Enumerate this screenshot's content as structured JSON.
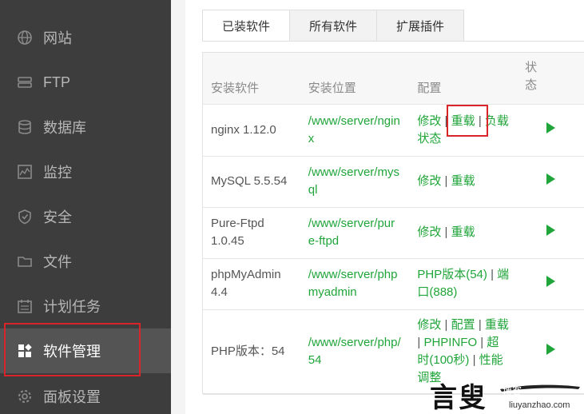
{
  "sidebar": {
    "items": [
      {
        "label": "网站",
        "icon": "globe-icon"
      },
      {
        "label": "FTP",
        "icon": "ftp-icon"
      },
      {
        "label": "数据库",
        "icon": "database-icon"
      },
      {
        "label": "监控",
        "icon": "monitor-icon"
      },
      {
        "label": "安全",
        "icon": "shield-icon"
      },
      {
        "label": "文件",
        "icon": "folder-icon"
      },
      {
        "label": "计划任务",
        "icon": "calendar-icon"
      },
      {
        "label": "软件管理",
        "icon": "apps-icon",
        "active": true
      },
      {
        "label": "面板设置",
        "icon": "gear-icon"
      }
    ]
  },
  "tabs": [
    {
      "label": "已装软件",
      "active": true
    },
    {
      "label": "所有软件"
    },
    {
      "label": "扩展插件"
    }
  ],
  "table": {
    "headers": [
      "安装软件",
      "安装位置",
      "配置",
      "状态"
    ],
    "rows": [
      {
        "name": "nginx 1.12.0",
        "path": "/www/server/nginx",
        "config": [
          "修改",
          "重载",
          "负载状态"
        ]
      },
      {
        "name": "MySQL 5.5.54",
        "path": "/www/server/mysql",
        "config": [
          "修改",
          "重载"
        ]
      },
      {
        "name": "Pure-Ftpd 1.0.45",
        "path": "/www/server/pure-ftpd",
        "config": [
          "修改",
          "重载"
        ]
      },
      {
        "name": "phpMyAdmin 4.4",
        "path": "/www/server/phpmyadmin",
        "config": [
          "PHP版本(54)",
          "端口(888)"
        ]
      },
      {
        "name": "PHP版本：54",
        "path": "/www/server/php/54",
        "config": [
          "修改",
          "配置",
          "重载",
          "PHPINFO",
          "超时(100秒)",
          "性能调整"
        ]
      }
    ]
  },
  "watermark": {
    "big": "言叟",
    "small": "博客",
    "url": "liuyanzhao.com"
  },
  "colors": {
    "sidebar_bg": "#3d3d3d",
    "sidebar_active": "#545454",
    "accent_green": "#20a53a",
    "highlight_red": "#d9252a"
  }
}
